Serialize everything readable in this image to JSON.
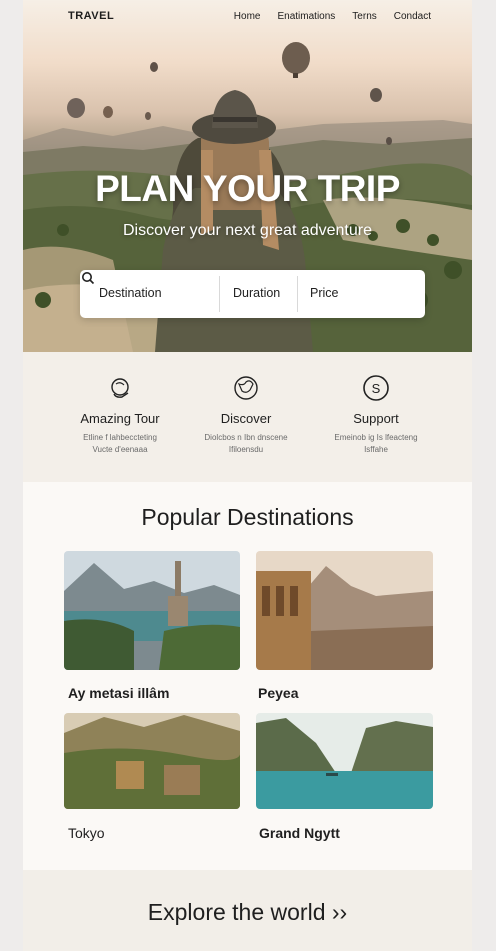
{
  "header": {
    "logo": "TRAVEL",
    "nav": [
      "Home",
      "Enatimations",
      "Terns",
      "Condact"
    ]
  },
  "hero": {
    "title": "PLAN YOUR TRIP",
    "subtitle": "Discover your next great adventure"
  },
  "search": {
    "destination": "Destination",
    "duration": "Duration",
    "price": "Price",
    "icon": "search-icon"
  },
  "features": [
    {
      "title": "Amazing Tour",
      "desc1": "Etline f lahbeccteting",
      "desc2": "Vucte d'eenaaa",
      "icon": "hand-globe-icon"
    },
    {
      "title": "Discover",
      "desc1": "Diolcbos n Ibn dnscene",
      "desc2": "Ifiloensdu",
      "icon": "globe-icon"
    },
    {
      "title": "Support",
      "desc1": "Emeinob ig Is lfeacteng",
      "desc2": "Isffahe",
      "icon": "dollar-icon"
    }
  ],
  "popular": {
    "title": "Popular Destinations",
    "cards": [
      {
        "caption": "Ay metasi illâm"
      },
      {
        "caption": "Peyea"
      },
      {
        "caption": "Tokyo"
      },
      {
        "caption": "Grand Ngytt"
      }
    ]
  },
  "footer": {
    "explore": "Explore the world ››"
  }
}
